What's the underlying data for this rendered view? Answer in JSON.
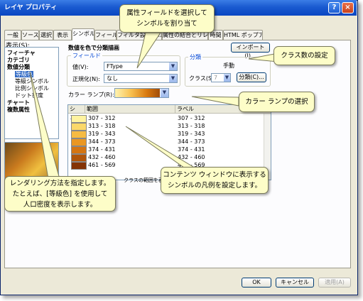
{
  "window": {
    "title": "レイヤ プロパティ",
    "help_label": "?",
    "close_label": "×"
  },
  "tabs": [
    "一般",
    "ソース",
    "選択",
    "表示",
    "シンボル",
    "フィールド",
    "フィルタ設定",
    "ラベル",
    "属性の結合とリレート",
    "時間",
    "HTML ポップアップ"
  ],
  "active_tab_index": 4,
  "display_label": "表示(S):",
  "tree": {
    "items": [
      {
        "label": "フィーチャ",
        "level": 0
      },
      {
        "label": "カテゴリ",
        "level": 0
      },
      {
        "label": "数値分類",
        "level": 0
      },
      {
        "label": "等級色",
        "level": 1,
        "selected": true
      },
      {
        "label": "等級シンボル",
        "level": 1
      },
      {
        "label": "比例シンボル",
        "level": 1
      },
      {
        "label": "ドット密度",
        "level": 1
      },
      {
        "label": "チャート",
        "level": 0
      },
      {
        "label": "複数属性",
        "level": 0
      }
    ]
  },
  "main": {
    "heading": "数値を色で分類描画",
    "import_button": "インポート(I)...",
    "field_group": {
      "title": "フィールド",
      "value_label": "値(V):",
      "value": "FType",
      "normalize_label": "正規化(N):",
      "normalize": "なし"
    },
    "classification_group": {
      "title": "分類",
      "method": "手動",
      "classes_label": "クラス(S):",
      "classes_value": "7",
      "classify_button": "分類(C)..."
    },
    "color_ramp_label": "カラー ランプ(R):",
    "table": {
      "headers": [
        "シン...",
        "範囲",
        "ラベル"
      ],
      "rows": [
        {
          "color": "#fff3a0",
          "range": "307 - 312",
          "label": "307 - 312"
        },
        {
          "color": "#fbd86a",
          "range": "313 - 318",
          "label": "313 - 318"
        },
        {
          "color": "#f6bb43",
          "range": "319 - 343",
          "label": "319 - 343"
        },
        {
          "color": "#ea9722",
          "range": "344 - 373",
          "label": "344 - 373"
        },
        {
          "color": "#d47512",
          "range": "374 - 431",
          "label": "374 - 431"
        },
        {
          "color": "#b0550a",
          "range": "432 - 460",
          "label": "432 - 460"
        },
        {
          "color": "#843406",
          "range": "461 - 569",
          "label": "461 - 569"
        }
      ]
    },
    "show_class_ranges": "クラスの範囲を表示"
  },
  "footer": {
    "ok": "OK",
    "cancel": "キャンセル",
    "apply": "適用(A)"
  },
  "callouts": {
    "top": [
      "属性フィールドを選択して",
      "シンボルを割り当て"
    ],
    "classes": "クラス数の設定",
    "ramp": "カラー ランプの選択",
    "contents": [
      "コンテンツ ウィンドウに表示する",
      "シンボルの凡例を設定します。"
    ],
    "render": [
      "レンダリング方法を指定します。",
      "たとえば、[等級色] を使用して",
      "人口密度を表示します。"
    ]
  },
  "colors": {
    "callout_bg": "#fdfdc8",
    "titlebar": "#0a46c2",
    "selection": "#316ac5"
  }
}
